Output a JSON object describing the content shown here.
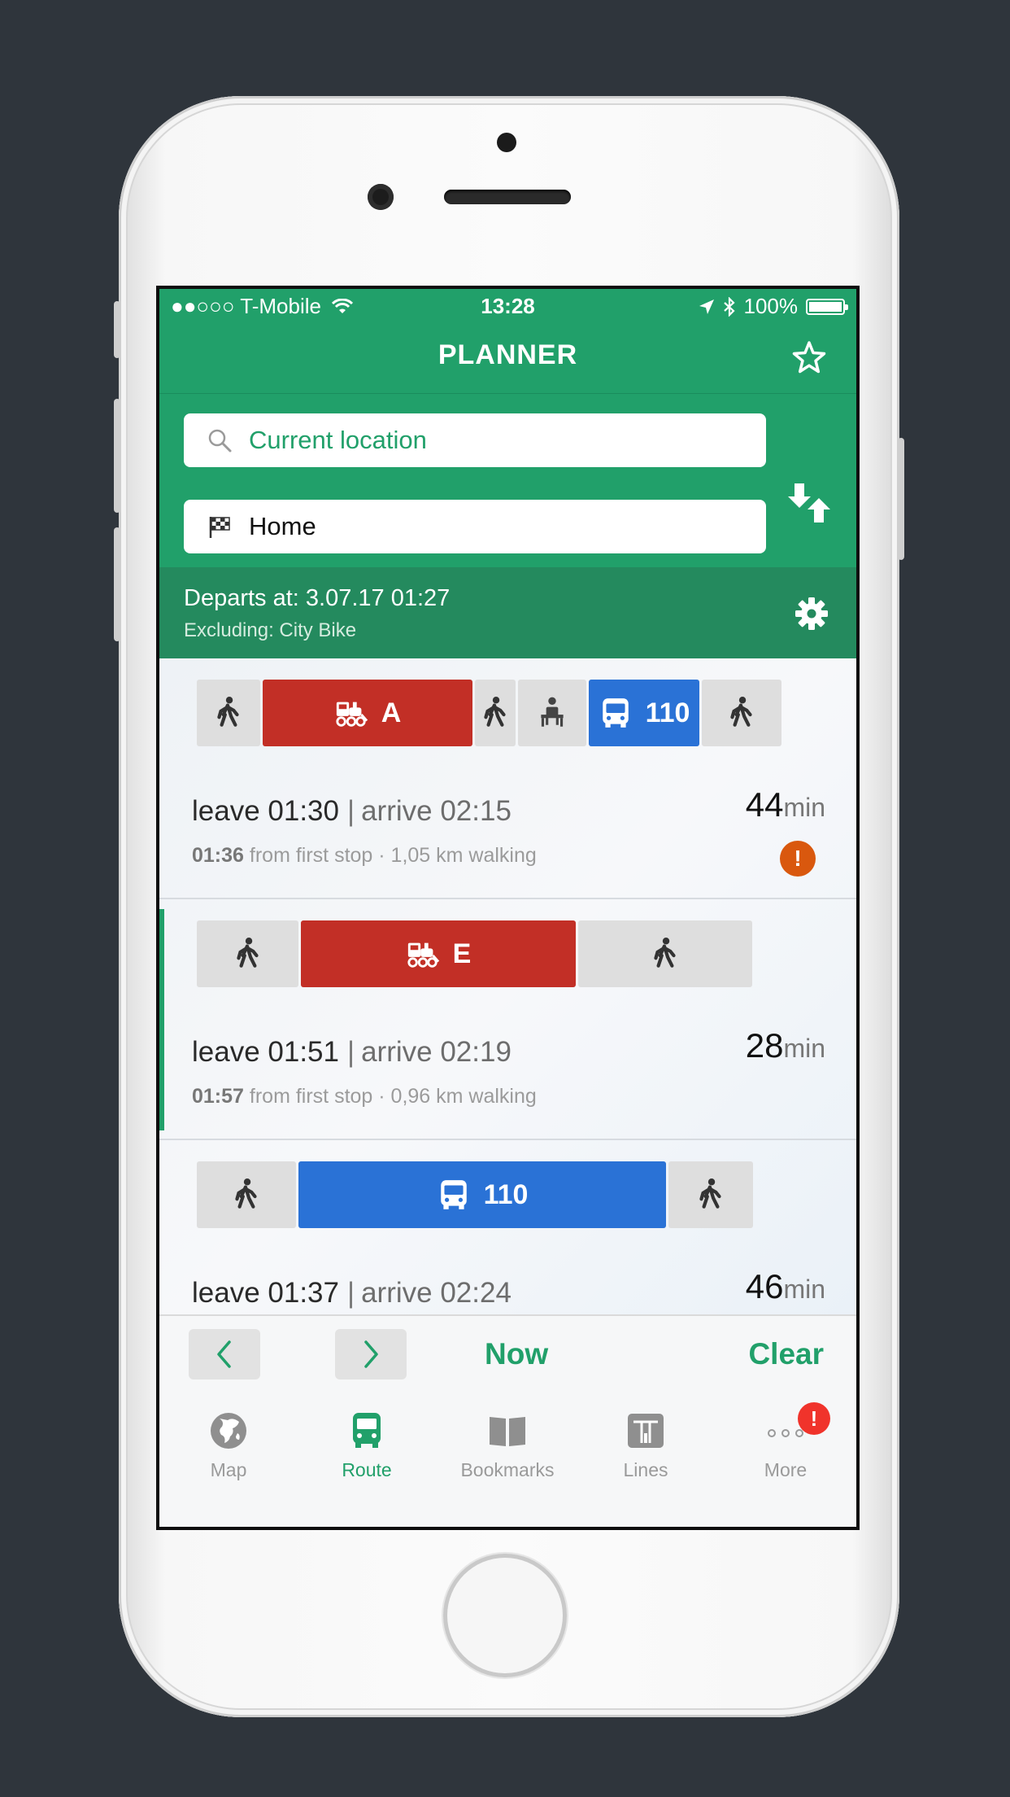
{
  "status_bar": {
    "carrier": "●●○○○ T-Mobile",
    "time": "13:28",
    "battery": "100%"
  },
  "header": {
    "title": "PLANNER"
  },
  "search": {
    "from": "Current location",
    "to": "Home"
  },
  "departs": {
    "line1": "Departs at: 3.07.17 01:27",
    "line2": "Excluding: City Bike"
  },
  "routes": [
    {
      "legs": [
        {
          "type": "walk"
        },
        {
          "type": "train",
          "label": "A"
        },
        {
          "type": "walk"
        },
        {
          "type": "bench"
        },
        {
          "type": "bus",
          "label": "110"
        },
        {
          "type": "walk"
        }
      ],
      "leave": "leave 01:30",
      "arrive": "arrive 02:15",
      "duration": "44",
      "unit": "min",
      "first_stop_time": "01:36",
      "details": "from first stop · 1,05 km walking",
      "warning": "!"
    },
    {
      "legs": [
        {
          "type": "walk"
        },
        {
          "type": "train",
          "label": "E"
        },
        {
          "type": "walk"
        }
      ],
      "leave": "leave 01:51",
      "arrive": "arrive 02:19",
      "duration": "28",
      "unit": "min",
      "first_stop_time": "01:57",
      "details": "from first stop · 0,96 km walking"
    },
    {
      "legs": [
        {
          "type": "walk"
        },
        {
          "type": "bus",
          "label": "110"
        },
        {
          "type": "walk"
        }
      ],
      "leave": "leave 01:37",
      "arrive": "arrive 02:24",
      "duration": "46",
      "unit": "min"
    }
  ],
  "toolbar": {
    "now": "Now",
    "clear": "Clear"
  },
  "tabs": {
    "map": "Map",
    "route": "Route",
    "bookmarks": "Bookmarks",
    "lines": "Lines",
    "more": "More",
    "more_badge": "!"
  },
  "colors": {
    "primary": "#21a06a",
    "departs_bg": "#248a5e",
    "train": "#c22f26",
    "bus": "#2a72d6",
    "warning": "#d9580e",
    "badge": "#f0332b"
  }
}
